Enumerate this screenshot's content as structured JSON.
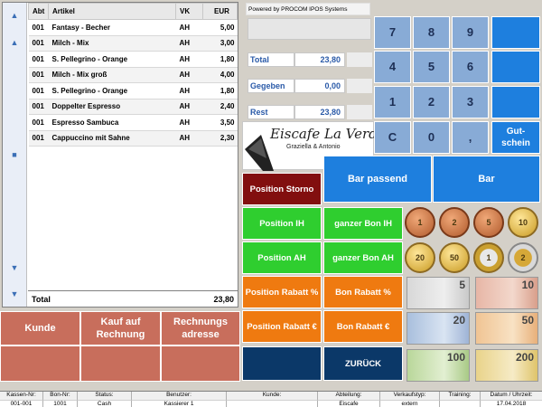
{
  "receipt": {
    "headers": {
      "abt": "Abt",
      "artikel": "Artikel",
      "vk": "VK",
      "eur": "EUR"
    },
    "items": [
      {
        "abt": "001",
        "artikel": "Fantasy - Becher",
        "vk": "AH",
        "eur": "5,00"
      },
      {
        "abt": "001",
        "artikel": "Milch - Mix",
        "vk": "AH",
        "eur": "3,00"
      },
      {
        "abt": "001",
        "artikel": "S. Pellegrino - Orange",
        "vk": "AH",
        "eur": "1,80"
      },
      {
        "abt": "001",
        "artikel": "Milch - Mix groß",
        "vk": "AH",
        "eur": "4,00"
      },
      {
        "abt": "001",
        "artikel": "S. Pellegrino - Orange",
        "vk": "AH",
        "eur": "1,80"
      },
      {
        "abt": "001",
        "artikel": "Doppelter Espresso",
        "vk": "AH",
        "eur": "2,40"
      },
      {
        "abt": "001",
        "artikel": "Espresso Sambuca",
        "vk": "AH",
        "eur": "3,50"
      },
      {
        "abt": "001",
        "artikel": "Cappuccino mit Sahne",
        "vk": "AH",
        "eur": "2,30"
      }
    ],
    "total_label": "Total",
    "total_value": "23,80"
  },
  "left_buttons": {
    "kunde": "Kunde",
    "kauf_auf_rechnung": "Kauf auf Rechnung",
    "rechnungs_adresse": "Rechnungs adresse"
  },
  "info": {
    "powered_by": "Powered by PROCOM IPOS Systems",
    "total_label": "Total",
    "total_value": "23,80",
    "gegeben_label": "Gegeben",
    "gegeben_value": "0,00",
    "rest_label": "Rest",
    "rest_value": "23,80"
  },
  "logo": {
    "name": "Eiscafe La Verde",
    "subtitle": "Graziella & Antonio"
  },
  "numpad": {
    "k7": "7",
    "k8": "8",
    "k9": "9",
    "k4": "4",
    "k5": "5",
    "k6": "6",
    "k1": "1",
    "k2": "2",
    "k3": "3",
    "kc": "C",
    "k0": "0",
    "kcomma": ",",
    "gutschein": "Gut- schein"
  },
  "pay": {
    "bar_passend": "Bar passend",
    "bar": "Bar"
  },
  "functions": {
    "position_storno": "Position Storno",
    "position_ih": "Position IH",
    "ganzer_bon_ih": "ganzer Bon IH",
    "position_ah": "Position AH",
    "ganzer_bon_ah": "ganzer Bon AH",
    "position_rabatt_pct": "Position Rabatt %",
    "bon_rabatt_pct": "Bon Rabatt %",
    "position_rabatt_eur": "Position Rabatt €",
    "bon_rabatt_eur": "Bon Rabatt €",
    "zurueck": "ZURÜCK"
  },
  "money": {
    "coins": [
      "1 cent",
      "2 cent",
      "5 cent",
      "10 cent",
      "20 cent",
      "50 cent",
      "1 euro",
      "2 euro"
    ],
    "coin_labels": [
      "1",
      "2",
      "5",
      "10",
      "20",
      "50",
      "1",
      "2"
    ],
    "notes": [
      "5",
      "10",
      "20",
      "50",
      "100",
      "200"
    ]
  },
  "status": {
    "kassen_nr_label": "Kassen-Nr:",
    "kassen_nr": "001-001",
    "bon_nr_label": "Bon-Nr:",
    "bon_nr": "1001",
    "status_label": "Status:",
    "status": "Cash",
    "benutzer_label": "Benutzer:",
    "benutzer": "Kassierer 1",
    "kunde_label": "Kunde:",
    "kunde": "",
    "abteilung_label": "Abteilung:",
    "abteilung": "Eiscafe",
    "verkaufstyp_label": "Verkaufstyp:",
    "verkaufstyp": "extern",
    "training_label": "Training:",
    "training": "",
    "datum_label": "Datum / Uhrzeit:",
    "datum": "17.04.2018"
  },
  "colors": {
    "accent_blue": "#1e7fde",
    "numpad_blue": "#88abd6",
    "storno_red": "#820f0f",
    "green": "#2fce2f",
    "orange": "#ef7a10",
    "navy": "#0b3868",
    "left_red": "#c86e5c"
  }
}
